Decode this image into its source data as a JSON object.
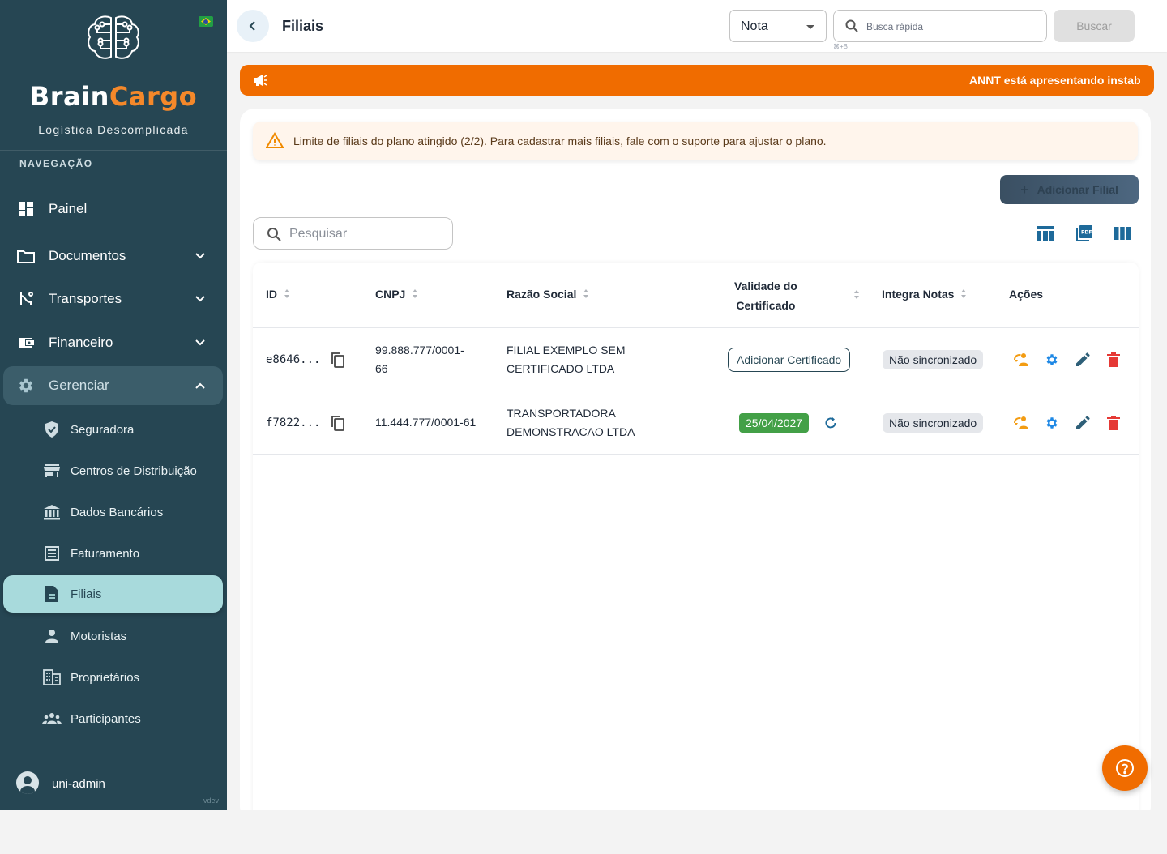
{
  "sidebar": {
    "brand_part1": "Brain",
    "brand_part2": "Cargo",
    "tagline": "Logística Descomplicada",
    "nav_heading": "NAVEGAÇÃO",
    "items": [
      {
        "label": "Painel",
        "icon": "dashboard-icon"
      },
      {
        "label": "Documentos",
        "icon": "folder-icon"
      },
      {
        "label": "Transportes",
        "icon": "route-icon"
      },
      {
        "label": "Financeiro",
        "icon": "wallet-icon"
      },
      {
        "label": "Gerenciar",
        "icon": "gear-icon"
      }
    ],
    "sub_items": [
      {
        "label": "Seguradora",
        "icon": "shield-icon"
      },
      {
        "label": "Centros de Distribuição",
        "icon": "store-icon"
      },
      {
        "label": "Dados Bancários",
        "icon": "bank-icon"
      },
      {
        "label": "Faturamento",
        "icon": "receipt-icon"
      },
      {
        "label": "Filiais",
        "icon": "document-icon"
      },
      {
        "label": "Motoristas",
        "icon": "person-icon"
      },
      {
        "label": "Proprietários",
        "icon": "building-icon"
      },
      {
        "label": "Participantes",
        "icon": "group-icon"
      }
    ],
    "user": "uni-admin",
    "version": "vdev"
  },
  "topbar": {
    "title": "Filiais",
    "select_value": "Nota",
    "search_placeholder": "Busca rápida",
    "shortcut": "⌘+B",
    "search_button": "Buscar"
  },
  "announcement": {
    "text": "ANNT está apresentando instab"
  },
  "content": {
    "warning": "Limite de filiais do plano atingido (2/2). Para cadastrar mais filiais, fale com o suporte para ajustar o plano.",
    "add_button": "Adicionar Filial",
    "search_placeholder": "Pesquisar",
    "columns": {
      "id": "ID",
      "cnpj": "CNPJ",
      "razao": "Razão Social",
      "validade_1": "Validade do",
      "validade_2": "Certificado",
      "integra": "Integra Notas",
      "acoes": "Ações"
    },
    "rows": [
      {
        "id": "e8646...",
        "cnpj_1": "99.888.777/0001-",
        "cnpj_2": "66",
        "razao_1": "FILIAL EXEMPLO SEM",
        "razao_2": "CERTIFICADO LTDA",
        "certificate_action": "Adicionar Certificado",
        "integra": "Não sincronizado"
      },
      {
        "id": "f7822...",
        "cnpj_1": "11.444.777/0001-61",
        "razao_1": "TRANSPORTADORA",
        "razao_2": "DEMONSTRACAO LTDA",
        "validade": "25/04/2027",
        "integra": "Não sincronizado"
      }
    ]
  },
  "colors": {
    "sidebar": "#264653",
    "accent": "#f06c00",
    "active": "#a8dadc",
    "success": "#43a047",
    "danger": "#e53935",
    "info": "#1e88e5"
  }
}
